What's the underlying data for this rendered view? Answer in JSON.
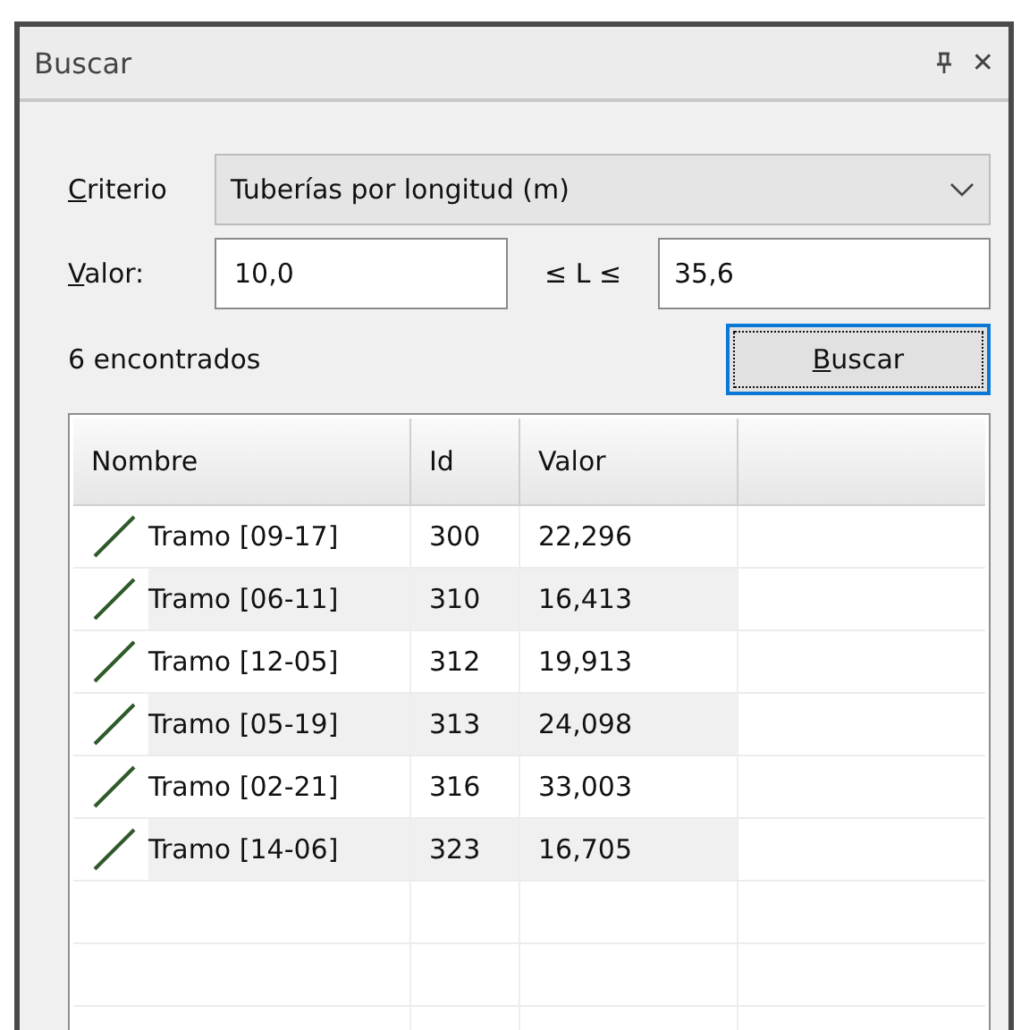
{
  "window": {
    "title": "Buscar",
    "close": "✕"
  },
  "criterio": {
    "label_key": "C",
    "label_rest": "riterio",
    "value": "Tuberías por longitud (m)"
  },
  "valor": {
    "label_key": "V",
    "label_rest": "alor:",
    "min": "10,0",
    "relation": "≤ L ≤",
    "max": "35,6"
  },
  "result_count": "6 encontrados",
  "search_button": {
    "label_key": "B",
    "label_rest": "uscar",
    "focused": true
  },
  "table": {
    "columns": [
      "Nombre",
      "Id",
      "Valor"
    ],
    "rows": [
      {
        "nombre": "Tramo [09-17]",
        "id": "300",
        "valor": "22,296"
      },
      {
        "nombre": "Tramo [06-11]",
        "id": "310",
        "valor": "16,413"
      },
      {
        "nombre": "Tramo [12-05]",
        "id": "312",
        "valor": "19,913"
      },
      {
        "nombre": "Tramo [05-19]",
        "id": "313",
        "valor": "24,098"
      },
      {
        "nombre": "Tramo [02-21]",
        "id": "316",
        "valor": "33,003"
      },
      {
        "nombre": "Tramo [14-06]",
        "id": "323",
        "valor": "16,705"
      }
    ]
  }
}
